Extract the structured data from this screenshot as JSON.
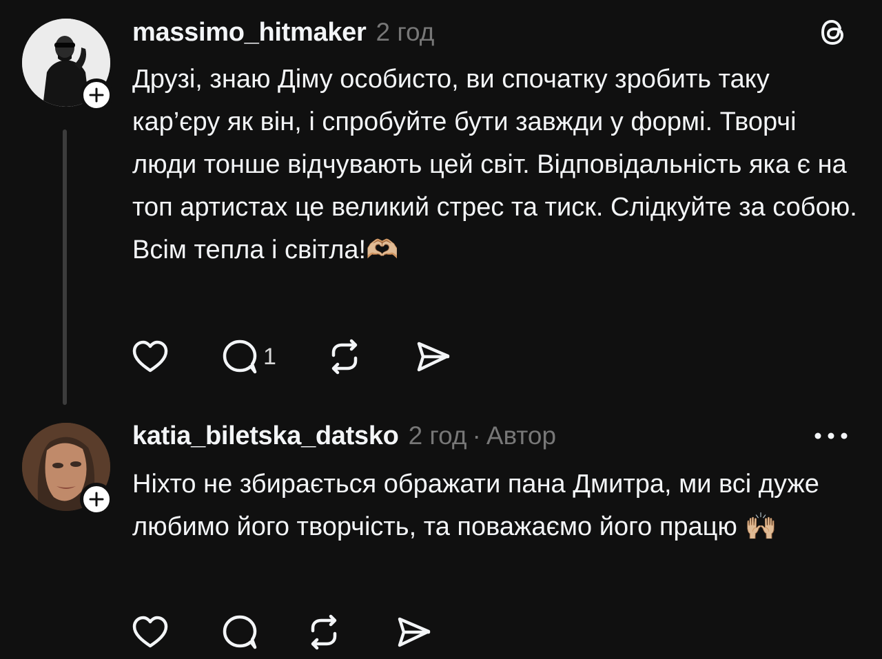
{
  "posts": [
    {
      "username": "massimo_hitmaker",
      "time": "2 год",
      "body": "Друзі, знаю Діму особисто, ви спочатку зробить таку кар’єру як він, і спробуйте бути завжди у формі. Творчі люди тонше відчувають цей світ. Відповідальність яка є на топ артистах це великий стрес та тиск. Слідкуйте за собою. Всім тепла і світла!🫶🏼",
      "reply_count": "1",
      "top_right_icon": "threads-logo-icon"
    },
    {
      "username": "katia_biletska_datsko",
      "time": "2 год",
      "separator": "·",
      "author_label": "Автор",
      "body": "Ніхто не збирається ображати пана Дмитра, ми всі дуже любимо його творчість, та поважаємо його працю 🙌🏼",
      "top_right_icon": "more-icon"
    }
  ],
  "icons": [
    "heart-icon",
    "comment-icon",
    "repost-icon",
    "share-icon",
    "plus-icon"
  ],
  "colors": {
    "background": "#101010",
    "text": "#f3f5f7",
    "secondary_text": "#777777",
    "thread_line": "#3c3c3c"
  }
}
